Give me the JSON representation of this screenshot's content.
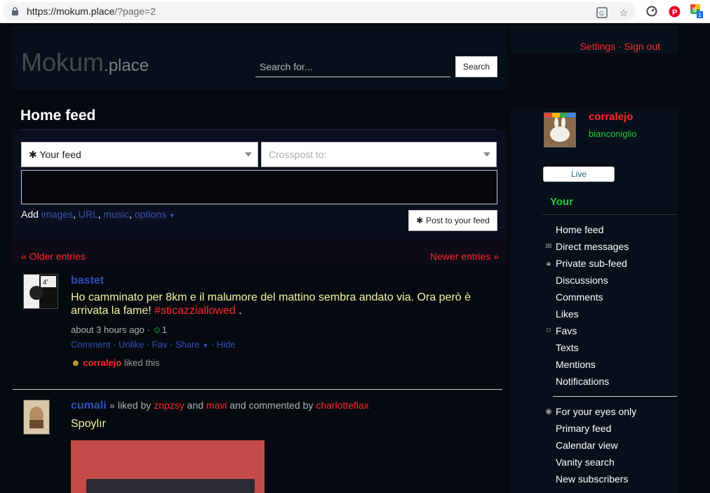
{
  "browser": {
    "url_host": "https://mokum.place",
    "url_path": "/?page=2",
    "icons": [
      "lock-icon",
      "translate-icon",
      "star-icon",
      "speedometer-icon",
      "pinterest-icon",
      "extension-icon"
    ]
  },
  "header": {
    "logo_main": "Mokum",
    "logo_sub": ".place",
    "search_placeholder": "Search for...",
    "search_button": "Search",
    "settings_link": "Settings",
    "separator": "·",
    "signout_link": "Sign out"
  },
  "composer": {
    "title": "Home feed",
    "feed_select": "Your feed",
    "feed_select_icon": "asterisk-icon",
    "crosspost_placeholder": "Crosspost to:",
    "add_label": "Add",
    "add_images": "images",
    "add_url": "URL",
    "add_music": "music",
    "add_options": "options",
    "post_button": "Post to your feed"
  },
  "pager": {
    "older": "« Older entries",
    "newer": "Newer entries »"
  },
  "posts": [
    {
      "author": "bastet",
      "text": "Ho camminato per 8km e il malumore del mattino sembra andato via. Ora però è arrivata la fame!",
      "hashtag": "#sticazziallowed",
      "after_tag": ".",
      "time": "about 3 hours ago",
      "dot": "·",
      "smile_count": "1",
      "actions": [
        "Comment",
        "Unlike",
        "Fav",
        "Share",
        "Hide"
      ],
      "liked_by": "corralejo",
      "liked_text": "liked this",
      "avatar_text": "4’"
    },
    {
      "author": "cumali",
      "byline_sep": "»",
      "liked_by_label": "liked by",
      "liker1": "znpzsy",
      "and_label": "and",
      "liker2": "mavi",
      "commented_label": "and commented by",
      "commenter": "charlotteflax",
      "text": "Spoylır"
    }
  ],
  "sidebar": {
    "username": "corralejo",
    "screenname": "bianconiglio",
    "live_button": "Live",
    "section": "Your",
    "items": [
      {
        "label": "Home feed",
        "icon": ""
      },
      {
        "label": "Direct messages",
        "icon": "envelope-icon"
      },
      {
        "label": "Private sub-feed",
        "icon": "lock-icon"
      },
      {
        "label": "Discussions",
        "icon": ""
      },
      {
        "label": "Comments",
        "icon": ""
      },
      {
        "label": "Likes",
        "icon": ""
      },
      {
        "label": "Favs",
        "icon": "bookmark-icon"
      },
      {
        "label": "Texts",
        "icon": ""
      },
      {
        "label": "Mentions",
        "icon": ""
      },
      {
        "label": "Notifications",
        "icon": ""
      }
    ],
    "items2": [
      {
        "label": "For your eyes only",
        "icon": "eye-icon"
      },
      {
        "label": "Primary feed",
        "icon": ""
      },
      {
        "label": "Calendar view",
        "icon": ""
      },
      {
        "label": "Vanity search",
        "icon": ""
      },
      {
        "label": "New subscribers",
        "icon": ""
      }
    ]
  },
  "colors": {
    "accent_red": "#ff2a2a",
    "link_blue": "#2f4fb8",
    "green": "#25c93a",
    "post_text": "#f5f5a0"
  }
}
